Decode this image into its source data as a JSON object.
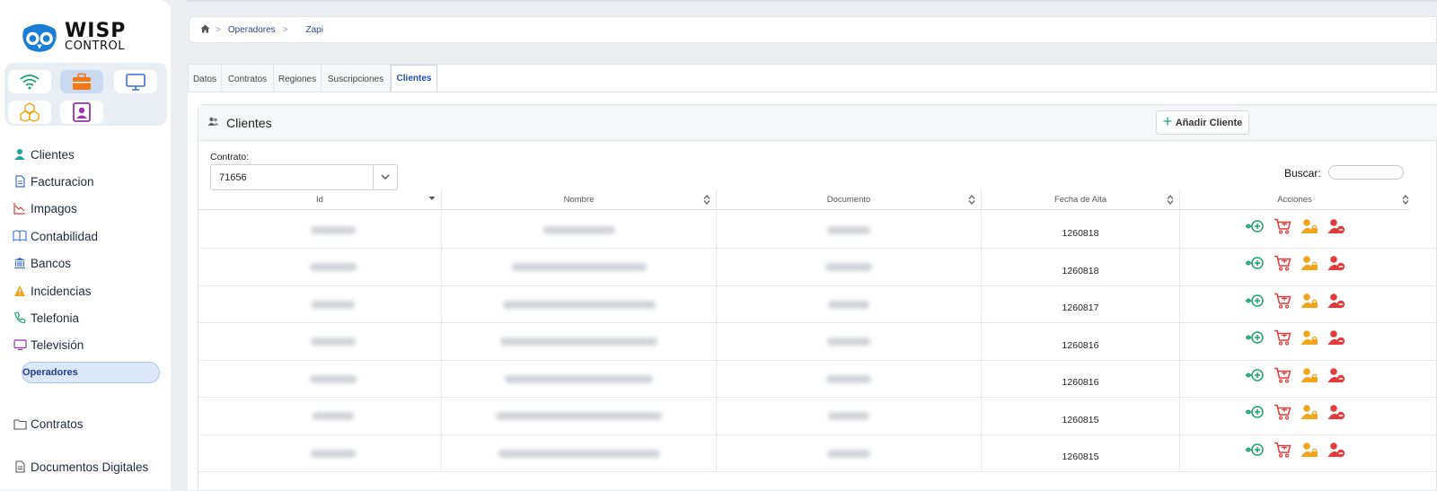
{
  "app": {
    "logo_line1": "WISP",
    "logo_line2": "CONTROL"
  },
  "quick_buttons": [
    {
      "icon": "wifi-icon",
      "color": "#1aa36b"
    },
    {
      "icon": "briefcase-icon",
      "color": "#f07a1a",
      "active": true
    },
    {
      "icon": "monitor-icon",
      "color": "#3a6fd8"
    },
    {
      "icon": "boxes-icon",
      "color": "#f0a51a"
    },
    {
      "icon": "contact-icon",
      "color": "#9b2fae"
    }
  ],
  "sidebar": {
    "items": [
      {
        "label": "Clientes",
        "icon": "user-icon",
        "color": "#1aa3a3"
      },
      {
        "label": "Facturacion",
        "icon": "invoice-icon",
        "color": "#3a6fd8"
      },
      {
        "label": "Impagos",
        "icon": "trend-down-icon",
        "color": "#d83a3a"
      },
      {
        "label": "Contabilidad",
        "icon": "book-icon",
        "color": "#3a6fd8"
      },
      {
        "label": "Bancos",
        "icon": "bank-icon",
        "color": "#3a6fd8"
      },
      {
        "label": "Incidencias",
        "icon": "warning-icon",
        "color": "#f0a51a"
      },
      {
        "label": "Telefonia",
        "icon": "phone-icon",
        "color": "#1aa36b"
      },
      {
        "label": "Televisión",
        "icon": "tv-icon",
        "color": "#9b2fae"
      }
    ],
    "active_sub": "Operadores",
    "bottom_items": [
      {
        "label": "Contratos",
        "icon": "folder-icon"
      },
      {
        "label": "Documentos Digitales",
        "icon": "document-icon"
      }
    ]
  },
  "breadcrumb": {
    "home_icon": "home-icon",
    "items": [
      "Operadores",
      "Zapi"
    ]
  },
  "tabs": [
    {
      "label": "Datos"
    },
    {
      "label": "Contratos"
    },
    {
      "label": "Regiones"
    },
    {
      "label": "Suscripciones"
    },
    {
      "label": "Clientes",
      "active": true
    }
  ],
  "card": {
    "title": "Clientes",
    "add_button": "Añadir Cliente",
    "contrato_label": "Contrato:",
    "contrato_value": "71656",
    "buscar_label": "Buscar:",
    "buscar_value": ""
  },
  "table": {
    "columns": [
      "Id",
      "Nombre",
      "Documento",
      "Fecha de Alta",
      "Acciones"
    ],
    "rows": [
      {
        "fecha": "1260818"
      },
      {
        "fecha": "1260818"
      },
      {
        "fecha": "1260817"
      },
      {
        "fecha": "1260816"
      },
      {
        "fecha": "1260816"
      },
      {
        "fecha": "1260815"
      },
      {
        "fecha": "1260815"
      }
    ],
    "action_icons": [
      "link-add-icon",
      "cart-icon",
      "user-lock-icon",
      "user-remove-icon"
    ]
  }
}
